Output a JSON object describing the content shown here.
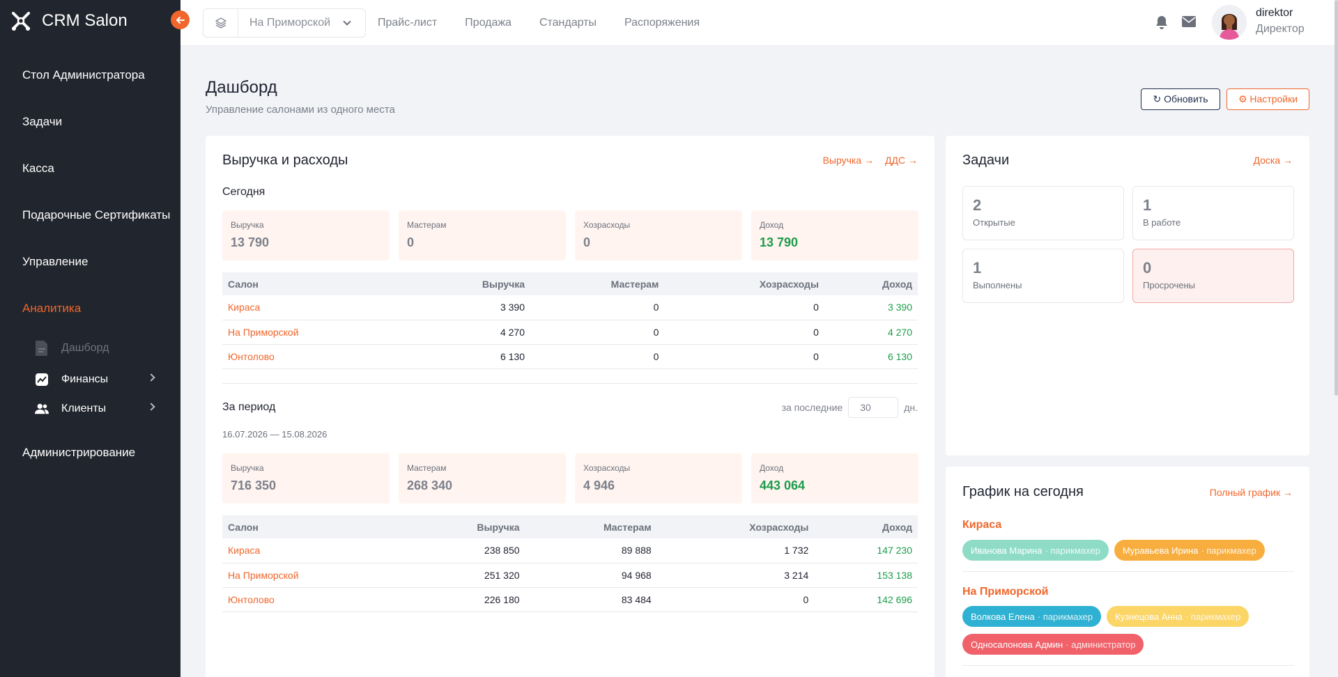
{
  "app": {
    "brand": "CRM Salon"
  },
  "sidebar": {
    "items": [
      {
        "label": "Стол Администратора"
      },
      {
        "label": "Задачи"
      },
      {
        "label": "Касса"
      },
      {
        "label": "Подарочные Сертификаты"
      },
      {
        "label": "Управление"
      },
      {
        "label": "Аналитика"
      }
    ],
    "analytics_sub": [
      {
        "label": "Дашборд",
        "icon": "document-icon"
      },
      {
        "label": "Финансы",
        "icon": "chart-icon"
      },
      {
        "label": "Клиенты",
        "icon": "users-icon"
      }
    ],
    "admin": {
      "label": "Администрирование"
    }
  },
  "topbar": {
    "salon_selected": "На Приморской",
    "nav": [
      "Прайс-лист",
      "Продажа",
      "Стандарты",
      "Распоряжения"
    ],
    "user_name": "direktor",
    "user_role": "Директор"
  },
  "page": {
    "title": "Дашборд",
    "subtitle": "Управление салонами из одного места",
    "refresh_label": "↻ Обновить",
    "settings_label": "⚙ Настройки"
  },
  "revenue": {
    "title": "Выручка и расходы",
    "links": [
      "Выручка →",
      "ДДС →"
    ],
    "today": {
      "title": "Сегодня",
      "stats": [
        {
          "label": "Выручка",
          "value": "13 790"
        },
        {
          "label": "Мастерам",
          "value": "0"
        },
        {
          "label": "Хозрасходы",
          "value": "0"
        },
        {
          "label": "Доход",
          "value": "13 790"
        }
      ],
      "columns": [
        "Салон",
        "Выручка",
        "Мастерам",
        "Хозрасходы",
        "Доход"
      ],
      "rows": [
        [
          "Кираса",
          "3 390",
          "0",
          "0",
          "3 390"
        ],
        [
          "На Приморской",
          "4 270",
          "0",
          "0",
          "4 270"
        ],
        [
          "Юнтолово",
          "6 130",
          "0",
          "0",
          "6 130"
        ]
      ]
    },
    "period": {
      "title": "За период",
      "filter_prefix": "за последние",
      "filter_value": "30",
      "filter_suffix": "дн.",
      "range": "16.07.2026 — 15.08.2026",
      "stats": [
        {
          "label": "Выручка",
          "value": "716 350"
        },
        {
          "label": "Мастерам",
          "value": "268 340"
        },
        {
          "label": "Хозрасходы",
          "value": "4 946"
        },
        {
          "label": "Доход",
          "value": "443 064"
        }
      ],
      "columns": [
        "Салон",
        "Выручка",
        "Мастерам",
        "Хозрасходы",
        "Доход"
      ],
      "rows": [
        [
          "Кираса",
          "238 850",
          "89 888",
          "1 732",
          "147 230"
        ],
        [
          "На Приморской",
          "251 320",
          "94 968",
          "3 214",
          "153 138"
        ],
        [
          "Юнтолово",
          "226 180",
          "83 484",
          "0",
          "142 696"
        ]
      ]
    }
  },
  "tasks": {
    "title": "Задачи",
    "link": "Доска →",
    "items": [
      {
        "count": "2",
        "label": "Открытые"
      },
      {
        "count": "1",
        "label": "В работе"
      },
      {
        "count": "1",
        "label": "Выполнены"
      },
      {
        "count": "0",
        "label": "Просрочены"
      }
    ]
  },
  "schedule": {
    "title": "График на сегодня",
    "link": "Полный график →",
    "salons": [
      {
        "name": "Кираса",
        "staff": [
          {
            "name": "Иванова Марина",
            "role": "· парикмахер"
          },
          {
            "name": "Муравьева Ирина",
            "role": "· парикмахер"
          }
        ]
      },
      {
        "name": "На Приморской",
        "staff": [
          {
            "name": "Волкова Елена",
            "role": "· парикмахер"
          },
          {
            "name": "Кузнецова Анна",
            "role": "· парикмахер"
          },
          {
            "name": "Односалонова Админ",
            "role": "· администратор"
          }
        ]
      }
    ]
  }
}
